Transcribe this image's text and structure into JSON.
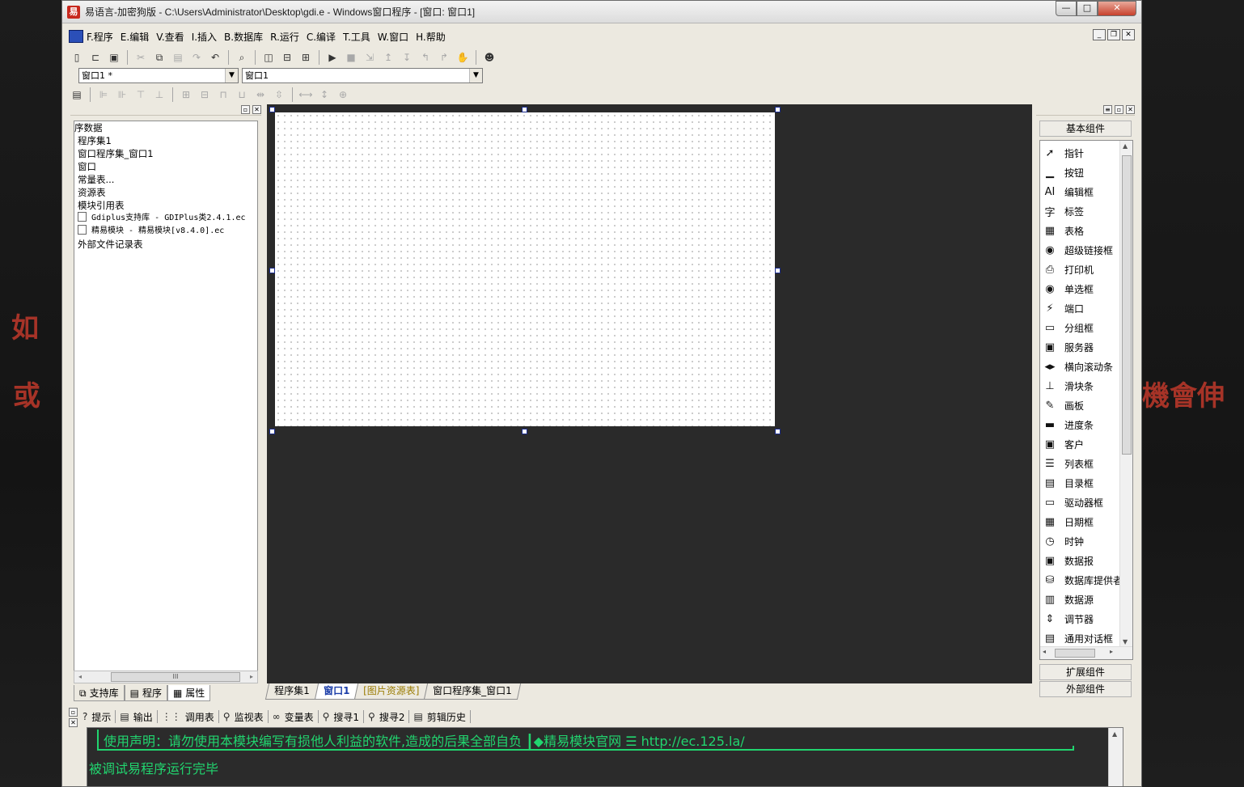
{
  "background": {
    "left_text_1": "如",
    "left_text_2": "或",
    "right_text": "機會伸"
  },
  "window": {
    "title": "易语言-加密狗版 - C:\\Users\\Administrator\\Desktop\\gdi.e - Windows窗口程序 - [窗口: 窗口1]",
    "app_icon_glyph": "易",
    "caption": {
      "minimize": "—",
      "maximize": "□",
      "close": "✕"
    }
  },
  "menu": {
    "items": [
      "F.程序",
      "E.编辑",
      "V.查看",
      "I.插入",
      "B.数据库",
      "R.运行",
      "C.编译",
      "T.工具",
      "W.窗口",
      "H.帮助"
    ],
    "mdi": {
      "minimize": "_",
      "restore": "❐",
      "close": "✕"
    }
  },
  "combos": {
    "object_value": "窗口1 *",
    "event_value": "窗口1"
  },
  "left_panel": {
    "tree": [
      "序数据",
      "程序集1",
      "窗口程序集_窗口1",
      "窗口",
      "常量表...",
      "资源表",
      "模块引用表"
    ],
    "modules": [
      "Gdiplus支持库 - GDIPlus类2.4.1.ec",
      "精易模块 - 精易模块[v8.4.0].ec"
    ],
    "tree_tail": "外部文件记录表",
    "tabs": [
      "支持库",
      "程序",
      "属性"
    ],
    "scroll_thumb": "III"
  },
  "doc_tabs": [
    "程序集1",
    "窗口1",
    "[图片资源表]",
    "窗口程序集_窗口1"
  ],
  "right_panel": {
    "basic_group": "基本组件",
    "components": [
      {
        "label": "指针",
        "icon": "pointer-icon",
        "glyph": "➚"
      },
      {
        "label": "按钮",
        "icon": "button-icon",
        "glyph": "▁"
      },
      {
        "label": "编辑框",
        "icon": "editbox-icon",
        "glyph": "AI"
      },
      {
        "label": "标签",
        "icon": "label-icon",
        "glyph": "字"
      },
      {
        "label": "表格",
        "icon": "grid-icon",
        "glyph": "▦"
      },
      {
        "label": "超级链接框",
        "icon": "hyperlink-icon",
        "glyph": "◉"
      },
      {
        "label": "打印机",
        "icon": "printer-icon",
        "glyph": "⎙"
      },
      {
        "label": "单选框",
        "icon": "radio-icon",
        "glyph": "◉"
      },
      {
        "label": "端口",
        "icon": "port-icon",
        "glyph": "⚡"
      },
      {
        "label": "分组框",
        "icon": "groupbox-icon",
        "glyph": "▭"
      },
      {
        "label": "服务器",
        "icon": "server-icon",
        "glyph": "▣"
      },
      {
        "label": "横向滚动条",
        "icon": "hscroll-icon",
        "glyph": "◂▸"
      },
      {
        "label": "滑块条",
        "icon": "slider-icon",
        "glyph": "⊥"
      },
      {
        "label": "画板",
        "icon": "canvas-icon",
        "glyph": "✎"
      },
      {
        "label": "进度条",
        "icon": "progress-icon",
        "glyph": "▬"
      },
      {
        "label": "客户",
        "icon": "client-icon",
        "glyph": "▣"
      },
      {
        "label": "列表框",
        "icon": "listbox-icon",
        "glyph": "☰"
      },
      {
        "label": "目录框",
        "icon": "dirbox-icon",
        "glyph": "▤"
      },
      {
        "label": "驱动器框",
        "icon": "drivebox-icon",
        "glyph": "▭"
      },
      {
        "label": "日期框",
        "icon": "datebox-icon",
        "glyph": "▦"
      },
      {
        "label": "时钟",
        "icon": "clock-icon",
        "glyph": "◷"
      },
      {
        "label": "数据报",
        "icon": "datagram-icon",
        "glyph": "▣"
      },
      {
        "label": "数据库提供者",
        "icon": "dbprovider-icon",
        "glyph": "⛁"
      },
      {
        "label": "数据源",
        "icon": "datasource-icon",
        "glyph": "▥"
      },
      {
        "label": "调节器",
        "icon": "spinner-icon",
        "glyph": "⇕"
      },
      {
        "label": "通用对话框",
        "icon": "dialog-icon",
        "glyph": "▤"
      }
    ],
    "ext_group": "扩展组件",
    "external_group": "外部组件",
    "scroll_thumb": "III"
  },
  "output": {
    "tabs": [
      {
        "label": "提示",
        "icon": "hint-icon",
        "glyph": "?"
      },
      {
        "label": "输出",
        "icon": "output-icon",
        "glyph": "▤"
      },
      {
        "label": "调用表",
        "icon": "callstack-icon",
        "glyph": "⋮⋮"
      },
      {
        "label": "监视表",
        "icon": "watch-icon",
        "glyph": "⚲"
      },
      {
        "label": "变量表",
        "icon": "variable-icon",
        "glyph": "∞"
      },
      {
        "label": "搜寻1",
        "icon": "search1-icon",
        "glyph": "⚲"
      },
      {
        "label": "搜寻2",
        "icon": "search2-icon",
        "glyph": "⚲"
      },
      {
        "label": "剪辑历史",
        "icon": "clip-history-icon",
        "glyph": "▤"
      }
    ],
    "line1": "使用声明：请勿使用本模块编写有损他人利益的软件,造成的后果全部自负 ┃◆精易模块官网    ☰ http://ec.125.la/",
    "line2": "被调试易程序运行完毕"
  },
  "colors": {
    "output_text": "#21d56f",
    "designer_bg": "#2a2a2a",
    "accent": "#1b3da8",
    "bg_text": "#c0392b"
  }
}
